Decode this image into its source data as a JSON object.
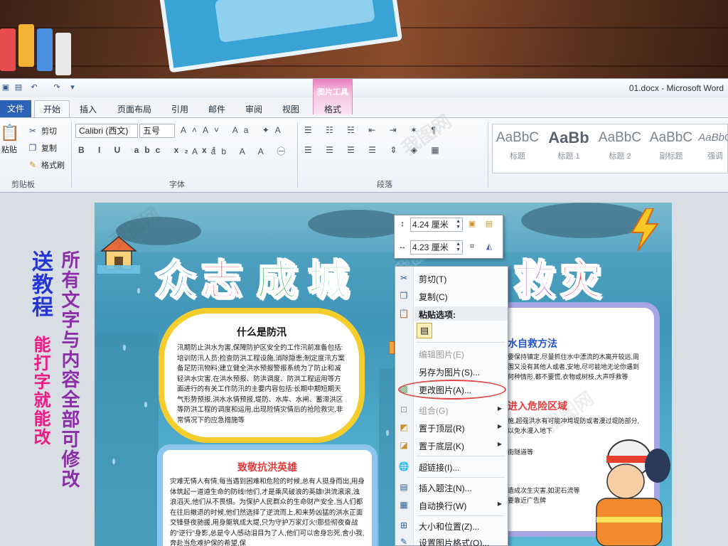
{
  "window": {
    "doc_title": "01.docx  -  Microsoft Word",
    "context_group": "图片工具",
    "tabs": [
      "文件",
      "开始",
      "插入",
      "页面布局",
      "引用",
      "邮件",
      "审阅",
      "视图",
      "格式"
    ]
  },
  "ribbon": {
    "clipboard": {
      "paste": "粘贴",
      "cut": "剪切",
      "copy": "复制",
      "format_painter": "格式刷",
      "label": "剪贴板"
    },
    "font": {
      "name": "Calibri (西文)",
      "size": "五号",
      "label": "字体"
    },
    "paragraph": {
      "label": "段落"
    },
    "styles": [
      {
        "sample": "AaBbC",
        "name": "标题"
      },
      {
        "sample": "AaBb",
        "name": "标题 1"
      },
      {
        "sample": "AaBbC",
        "name": "标题 2"
      },
      {
        "sample": "AaBbC",
        "name": "副标题"
      },
      {
        "sample": "AaBbC",
        "name": "强调"
      }
    ]
  },
  "side_text": {
    "line1": "送教程",
    "line2": "能打字就能改",
    "line3": "所有文字与内容全部可修改"
  },
  "poster": {
    "title_chars": [
      {
        "ch": "众",
        "color": "#1a8fe8"
      },
      {
        "ch": "志",
        "color": "#e8344d"
      },
      {
        "ch": "成",
        "color": "#2cb34a"
      },
      {
        "ch": "城",
        "color": "#2cb34a"
      },
      {
        "ch": "救",
        "color": "#8a2fd0"
      },
      {
        "ch": "灾",
        "color": "#e8344d"
      }
    ],
    "card1": {
      "title": "什么是防汛",
      "body": "汛期防止洪水为害,保障防护区安全的工作汛前准备包括:培训防汛人员;检查防洪工程设施,消除隐患;制定度汛方案备足防汛物料;建立健全洪水预报警报系统为了防止和减轻洪水灾害,在洪水预报、防洪调度、防洪工程运用等方面进行的有关工作防汛的主要内容包括:长期中期短期天气形势预报,洪水水情预报,堤防、水库、水闸、蓄滞洪区等防洪工程的调度和运用,出现险情灾情后的抢险救灾,非常情况下的应急措施等"
    },
    "card2": {
      "title": "致敬抗洪英雄",
      "body": "灾难无情人有情,每当遇到困难和危险的时候,总有人挺身而出,用身体筑起一道道生命的防线!他们,才是乘风破浪的英雄!洪流滚滚,浊浪滔天,他们从不畏惧。为保护人民群众的生命财产安全,当人们都在往后撤退的时候,他们然选择了逆流而上,和来势凶猛的洪水正面交锋昼夜驰援,用身躯筑成大堤,只为守护万家灯火!那些彻夜奋战的“逆行”身影,总是令人感动泪目为了人,他们可以舍身忘死,舍小我,奔赴当危难护保的希望,保"
    },
    "card3": {
      "h1": "水自救方法",
      "t1": "要保持镇定,尽量抓住水中漂流的木离开较远,周围又没有其他人或者,安地,尽可能地无论你遇到何种情形,都不要慌,衣物或树枝,大声呼救等",
      "h2": "进入危险区域",
      "t2": "施,超强洪水有可能冲垮堤防或者漫过堤防部分,以免水漫入地下",
      "t3": "街隧道等",
      "t4": "造成次生灾害,如泥石流等要靠近广告牌"
    }
  },
  "size_popup": {
    "height": "4.24 厘米",
    "width": "4.23 厘米"
  },
  "context_menu": {
    "items": [
      {
        "label": "剪切(T)",
        "icon": "scissors-icon",
        "enabled": true
      },
      {
        "label": "复制(C)",
        "icon": "copy-icon",
        "enabled": true
      },
      {
        "label": "粘贴选项:",
        "icon": "paste-icon",
        "enabled": true
      },
      {
        "label": "编辑图片(E)",
        "icon": "",
        "enabled": false
      },
      {
        "label": "另存为图片(S)...",
        "icon": "",
        "enabled": true
      },
      {
        "label": "更改图片(A)...",
        "icon": "change-picture-icon",
        "enabled": true
      },
      {
        "label": "组合(G)",
        "icon": "group-icon",
        "enabled": false
      },
      {
        "label": "置于顶层(R)",
        "icon": "bring-front-icon",
        "enabled": true
      },
      {
        "label": "置于底层(K)",
        "icon": "send-back-icon",
        "enabled": true
      },
      {
        "label": "超链接(I)...",
        "icon": "hyperlink-icon",
        "enabled": true
      },
      {
        "label": "插入题注(N)...",
        "icon": "caption-icon",
        "enabled": true
      },
      {
        "label": "自动换行(W)",
        "icon": "wrap-icon",
        "enabled": true
      },
      {
        "label": "大小和位置(Z)...",
        "icon": "size-position-icon",
        "enabled": true
      },
      {
        "label": "设置图片格式(O)...",
        "icon": "format-picture-icon",
        "enabled": true
      }
    ]
  }
}
